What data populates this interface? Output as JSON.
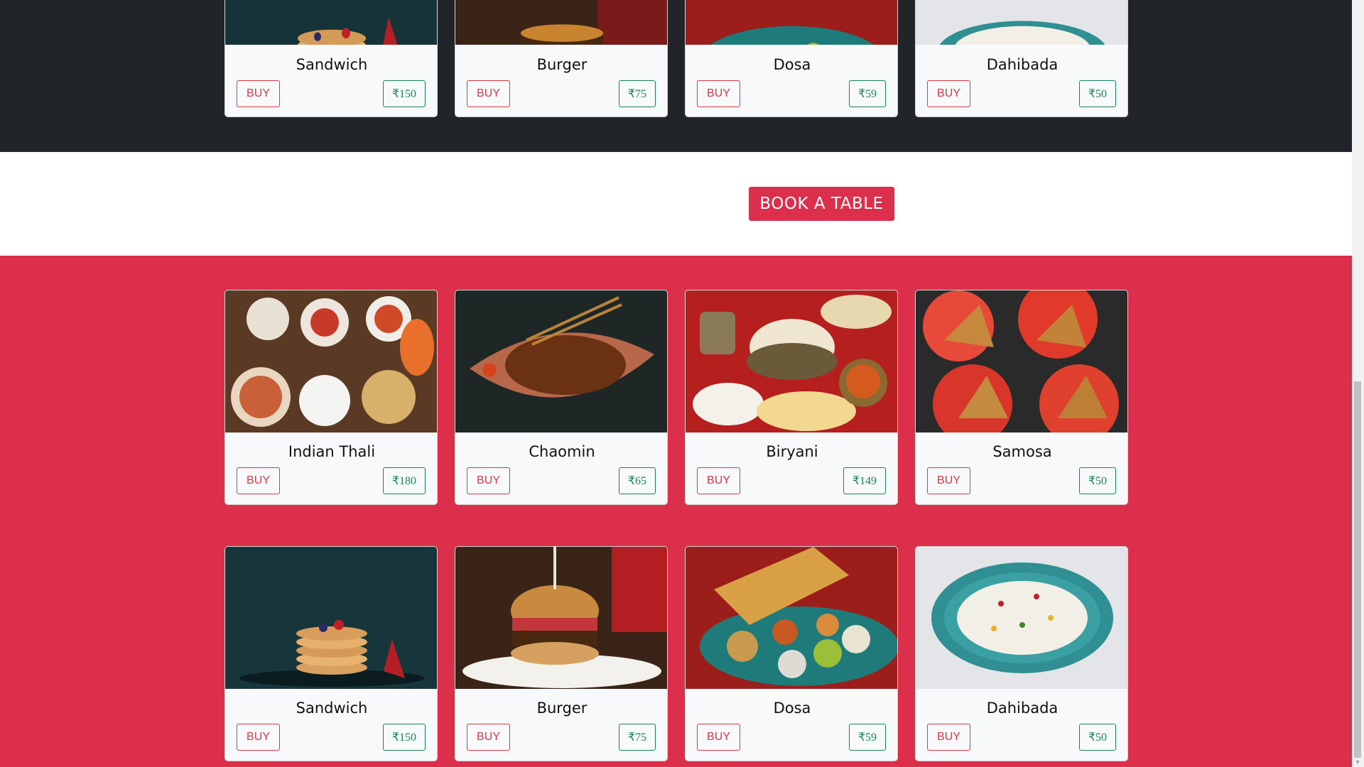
{
  "book_table": {
    "label": "BOOK A TABLE"
  },
  "buy_label": "BUY",
  "top_row": [
    {
      "name": "Sandwich",
      "price": "₹150"
    },
    {
      "name": "Burger",
      "price": "₹75"
    },
    {
      "name": "Dosa",
      "price": "₹59"
    },
    {
      "name": "Dahibada",
      "price": "₹50"
    }
  ],
  "row1": [
    {
      "name": "Indian Thali",
      "price": "₹180"
    },
    {
      "name": "Chaomin",
      "price": "₹65"
    },
    {
      "name": "Biryani",
      "price": "₹149"
    },
    {
      "name": "Samosa",
      "price": "₹50"
    }
  ],
  "row2": [
    {
      "name": "Sandwich",
      "price": "₹150"
    },
    {
      "name": "Burger",
      "price": "₹75"
    },
    {
      "name": "Dosa",
      "price": "₹59"
    },
    {
      "name": "Dahibada",
      "price": "₹50"
    }
  ],
  "colors": {
    "dark_section": "#212529",
    "red_section": "#dc2f4b",
    "buy_border": "#dc3545",
    "price_border": "#198754"
  }
}
